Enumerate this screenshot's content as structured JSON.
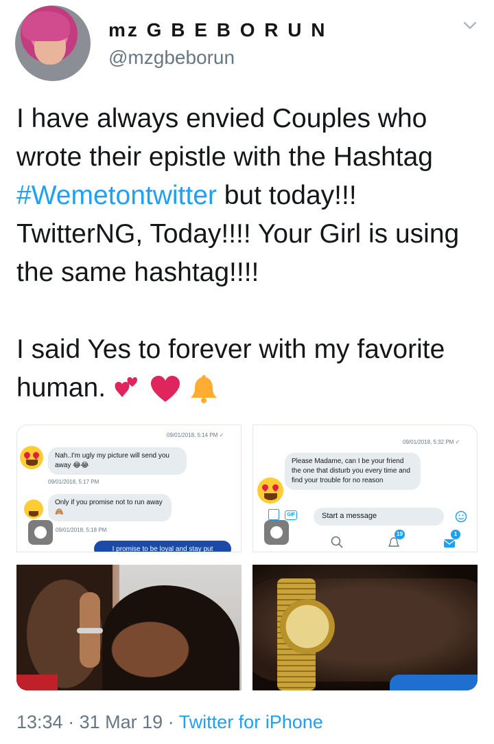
{
  "user": {
    "display_name": "mz G B E B O R U N",
    "handle": "@mzgbeborun"
  },
  "tweet": {
    "line_before_hashtag": "I have always envied Couples who wrote their epistle with the Hashtag ",
    "hashtag": "#Wemetontwitter",
    "line_after_hashtag": " but today!!! TwitterNG, Today!!!! Your Girl is using the same hashtag!!!!",
    "paragraph_2": "I said Yes to forever with my favorite human.",
    "emojis": [
      "two-hearts",
      "red-heart",
      "bell"
    ]
  },
  "media": {
    "chat1": {
      "ts1": "09/01/2018, 5:14 PM ✓",
      "bubble1": "Nah..I'm ugly my picture will send you away 😂😂",
      "ts2": "09/01/2018, 5:17 PM",
      "bubble2": "Only if you promise not to run away 🙈",
      "ts3": "09/01/2018, 5:18 PM",
      "bubble3": "I promise to be loyal and stay put"
    },
    "chat2": {
      "ts1": "09/01/2018, 5:32 PM ✓",
      "bubble1": "Please Madame, can I be your friend the one that disturb you every time and find your trouble for no reason",
      "gif_label": "GIF",
      "message_placeholder": "Start a message",
      "notifications_badge": "19",
      "messages_badge": "1"
    }
  },
  "footer": {
    "time": "13:34",
    "sep1": " · ",
    "date": "31 Mar 19",
    "sep2": " · ",
    "source": "Twitter for iPhone"
  },
  "colors": {
    "accent": "#1da1f2",
    "text": "#14171a",
    "muted": "#657786"
  }
}
